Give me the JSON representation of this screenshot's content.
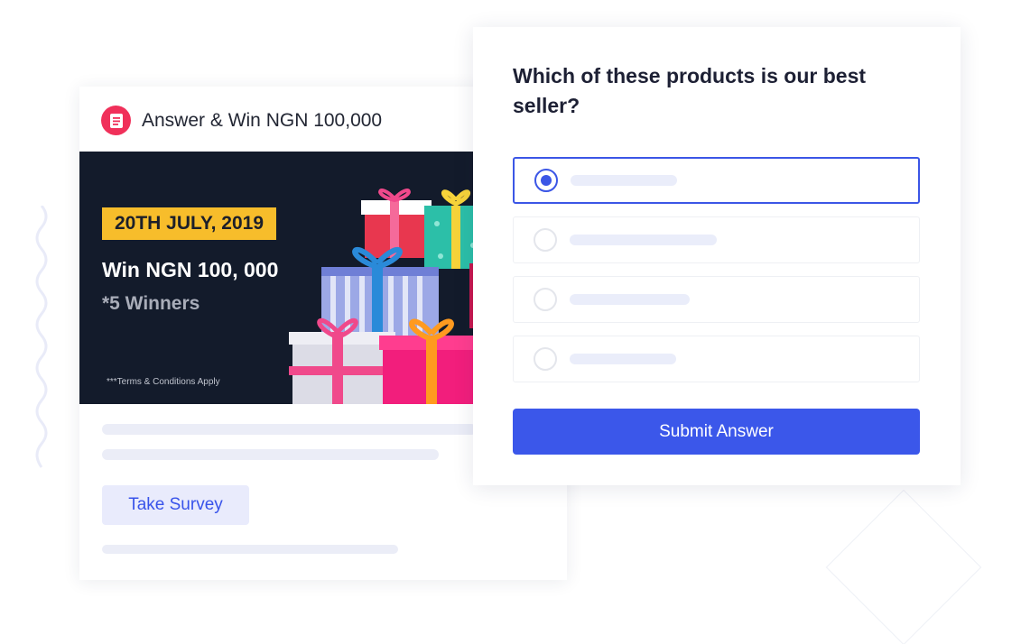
{
  "survey_card": {
    "title": "Answer & Win NGN 100,000",
    "banner": {
      "date": "20TH JULY, 2019",
      "prize": "Win NGN 100, 000",
      "winners": "*5 Winners",
      "terms": "***Terms & Conditions Apply"
    },
    "take_survey_label": "Take Survey"
  },
  "question_card": {
    "question": "Which of these products is our best seller?",
    "options": [
      {
        "selected": true
      },
      {
        "selected": false
      },
      {
        "selected": false
      },
      {
        "selected": false
      }
    ],
    "submit_label": "Submit Answer"
  },
  "colors": {
    "accent": "#3b57ea",
    "badge": "#f7bd2b",
    "icon_red": "#f0305a",
    "banner_bg": "#131b2b"
  },
  "icons": {
    "survey": "clipboard-list-icon"
  }
}
